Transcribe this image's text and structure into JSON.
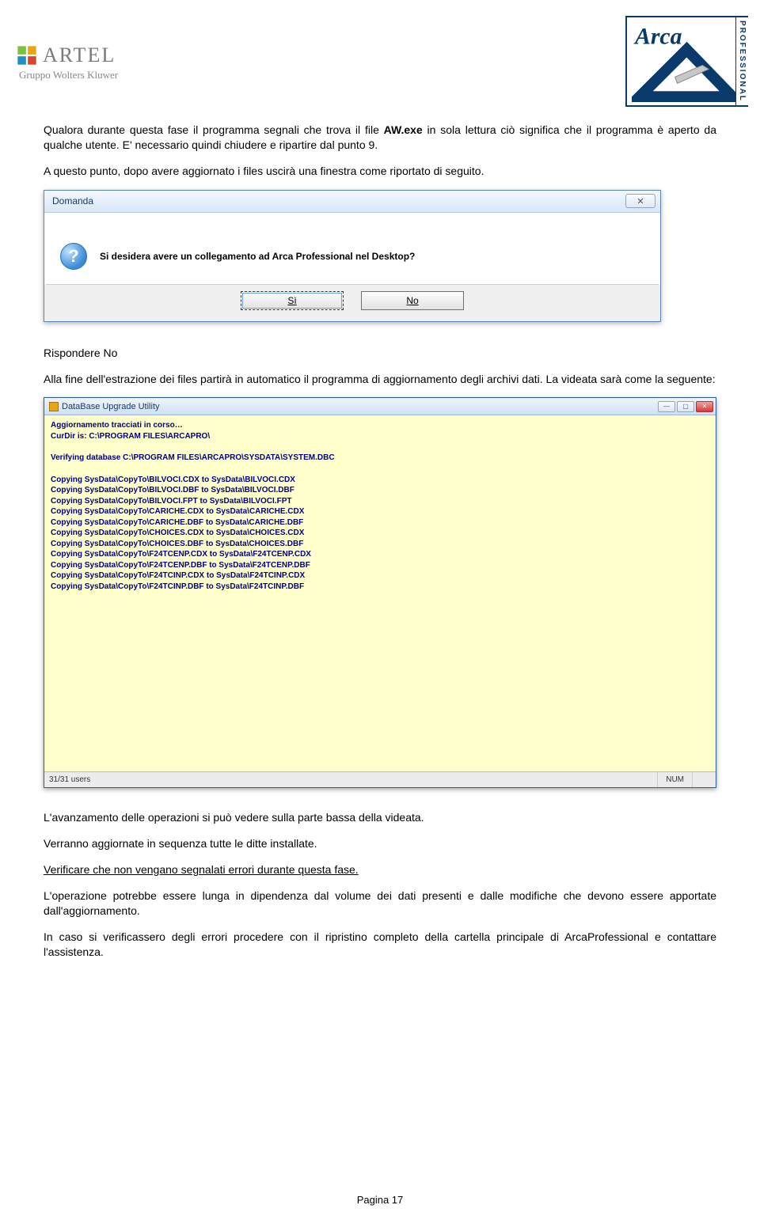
{
  "header": {
    "artel_name": "ARTEL",
    "artel_sub": "Gruppo Wolters Kluwer",
    "arca_text": "Arca",
    "arca_side": "PROFESSIONAL"
  },
  "para1_a": "Qualora durante questa fase il programma segnali che trova il file ",
  "para1_b": "AW.exe",
  "para1_c": " in sola lettura ciò significa che il programma è aperto da qualche utente. E' necessario quindi chiudere e ripartire dal punto 9.",
  "para2": "A questo punto, dopo avere aggiornato i files uscirà una finestra come riportato di seguito.",
  "dialog": {
    "title": "Domanda",
    "text": "Si desidera avere un collegamento ad Arca Professional nel Desktop?",
    "yes": "Sì",
    "no": "No",
    "close_glyph": "✕"
  },
  "para3": "Rispondere  No",
  "para4": "Alla fine dell'estrazione dei files partirà in automatico il programma di aggiornamento degli archivi dati. La videata sarà come la seguente:",
  "dbwin": {
    "title": "DataBase Upgrade Utility",
    "status_left": "31/31 users",
    "status_num": "NUM",
    "lines_group1": [
      "Aggiornamento tracciati in corso…",
      "CurDir is: C:\\PROGRAM FILES\\ARCAPRO\\"
    ],
    "lines_group2": [
      "Verifying database C:\\PROGRAM FILES\\ARCAPRO\\SYSDATA\\SYSTEM.DBC"
    ],
    "lines_group3": [
      "Copying SysData\\CopyTo\\BILVOCI.CDX to SysData\\BILVOCI.CDX",
      "Copying SysData\\CopyTo\\BILVOCI.DBF to SysData\\BILVOCI.DBF",
      "Copying SysData\\CopyTo\\BILVOCI.FPT to SysData\\BILVOCI.FPT",
      "Copying SysData\\CopyTo\\CARICHE.CDX to SysData\\CARICHE.CDX",
      "Copying SysData\\CopyTo\\CARICHE.DBF to SysData\\CARICHE.DBF",
      "Copying SysData\\CopyTo\\CHOICES.CDX to SysData\\CHOICES.CDX",
      "Copying SysData\\CopyTo\\CHOICES.DBF to SysData\\CHOICES.DBF",
      "Copying SysData\\CopyTo\\F24TCENP.CDX to SysData\\F24TCENP.CDX",
      "Copying SysData\\CopyTo\\F24TCENP.DBF to SysData\\F24TCENP.DBF",
      "Copying SysData\\CopyTo\\F24TCINP.CDX to SysData\\F24TCINP.CDX",
      "Copying SysData\\CopyTo\\F24TCINP.DBF to SysData\\F24TCINP.DBF"
    ]
  },
  "para5": "L'avanzamento delle operazioni si può vedere sulla parte bassa della videata.",
  "para6": "Verranno aggiornate in sequenza tutte le ditte installate.",
  "para7": "Verificare che non vengano segnalati errori durante questa fase.",
  "para8": "L'operazione potrebbe essere lunga in dipendenza dal volume dei dati presenti e dalle modifiche che devono essere apportate dall'aggiornamento.",
  "para9": "In caso si verificassero degli errori procedere con il ripristino completo della cartella principale di ArcaProfessional e contattare l'assistenza.",
  "footer": "Pagina 17"
}
